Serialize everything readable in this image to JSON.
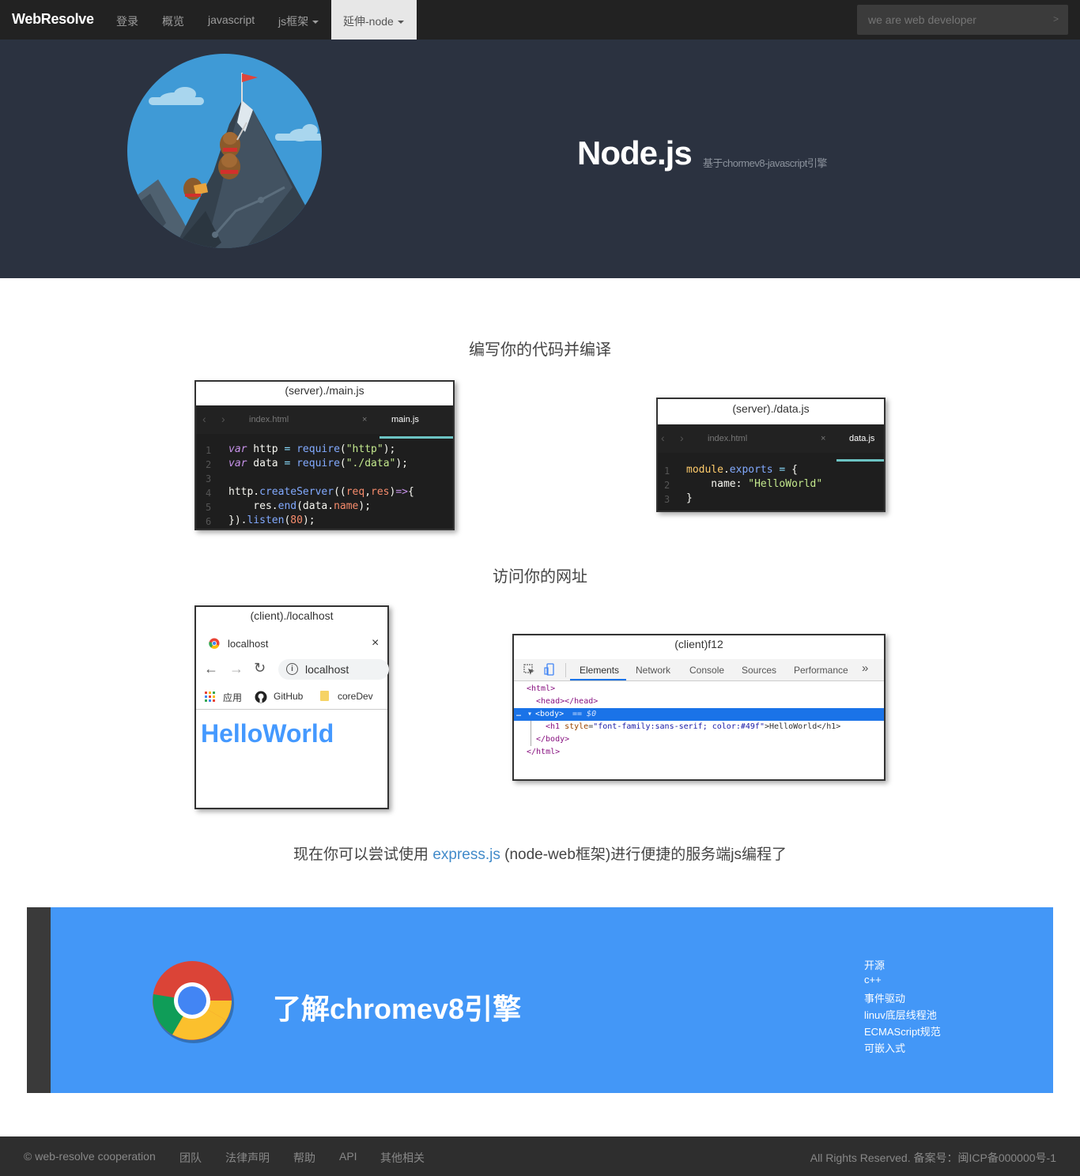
{
  "navbar": {
    "brand": "WebResolve",
    "items": [
      "登录",
      "概览",
      "javascript",
      "js框架",
      "延伸-node"
    ],
    "search_placeholder": "we are web developer",
    "search_go": ">"
  },
  "hero": {
    "title": "Node.js",
    "subtitle": "基于chormev8-javascript引擎"
  },
  "section1": {
    "title": "编写你的代码并编译",
    "main_window": {
      "caption": "(server)./main.js",
      "tabs": [
        "index.html",
        "main.js"
      ],
      "tab_close": "×",
      "line_numbers": [
        "1",
        "2",
        "3",
        "4",
        "5",
        "6"
      ]
    },
    "data_window": {
      "caption": "(server)./data.js",
      "tabs": [
        "index.html",
        "data.js"
      ],
      "tab_close": "×",
      "line_numbers": [
        "1",
        "2",
        "3"
      ]
    }
  },
  "section2": {
    "title": "访问你的网址",
    "client_window": {
      "caption": "(client)./localhost",
      "tab_title": "localhost",
      "tab_close": "×",
      "address": "localhost",
      "bookmarks": [
        "应用",
        "GitHub",
        "coreDev"
      ],
      "heading": "HelloWorld"
    },
    "devtools_window": {
      "caption": "(client)f12",
      "tabs": [
        "Elements",
        "Network",
        "Console",
        "Sources",
        "Performance"
      ],
      "more": "»",
      "lines": {
        "l1": "<html>",
        "l2": "<head></head>",
        "l3_tag": "<body>",
        "l3_eq": "== $0",
        "l4_open": "<h1 ",
        "l4_attr": "style",
        "l4_val": "\"font-family:sans-serif; color:#49f\"",
        "l4_text": ">HelloWorld</h1>",
        "l5": "</body>",
        "l6": "</html>"
      }
    }
  },
  "section3": {
    "before": "现在你可以尝试使用 ",
    "link": "express.js",
    "after": " (node-web框架)进行便捷的服务端js编程了"
  },
  "banner": {
    "title": "了解chromev8引擎",
    "features": [
      "开源",
      "c++",
      "事件驱动",
      "linuv底层线程池",
      "ECMAScript规范",
      "可嵌入式"
    ]
  },
  "footer": {
    "left": [
      "© web-resolve cooperation",
      "团队",
      "法律声明",
      "帮助",
      "API",
      "其他相关"
    ],
    "right": "All Rights Reserved. 备案号：闽ICP备000000号-1"
  },
  "colors": {
    "navbar": "#222222",
    "hero": "#2b3240",
    "banner": "#4397f7",
    "link": "#428bca",
    "footer": "#2e2e2e"
  }
}
